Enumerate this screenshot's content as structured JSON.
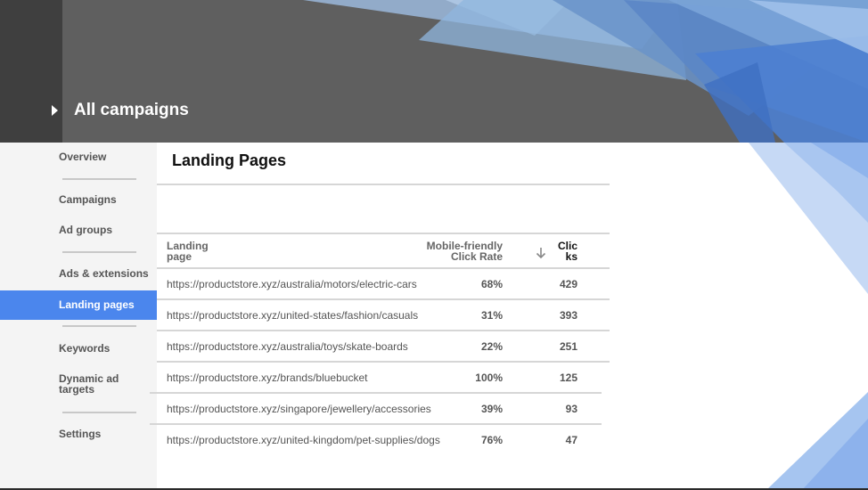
{
  "header": {
    "title": "All campaigns",
    "toggle_icon": "caret-right-icon"
  },
  "sidebar": {
    "items": [
      {
        "label": "Overview",
        "active": false
      },
      {
        "label": "Campaigns",
        "active": false
      },
      {
        "label": "Ad groups",
        "active": false
      },
      {
        "label": "Ads & extensions",
        "active": false
      },
      {
        "label": "Landing pages",
        "active": true
      },
      {
        "label": "Keywords",
        "active": false
      },
      {
        "label": "Dynamic ad targets",
        "active": false
      },
      {
        "label": "Settings",
        "active": false
      }
    ]
  },
  "main": {
    "title": "Landing Pages",
    "table": {
      "columns": {
        "landing_page": "Landing page",
        "mobile_rate": "Mobile-friendly Click Rate",
        "clicks": "Clicks"
      },
      "sort_icon": "arrow-down-icon",
      "rows": [
        {
          "url": "https://productstore.xyz/australia/motors/electric-cars",
          "rate": "68%",
          "clicks": "429"
        },
        {
          "url": "https://productstore.xyz/united-states/fashion/casuals",
          "rate": "31%",
          "clicks": "393"
        },
        {
          "url": "https://productstore.xyz/australia/toys/skate-boards",
          "rate": "22%",
          "clicks": "251"
        },
        {
          "url": "https://productstore.xyz/brands/bluebucket",
          "rate": "100%",
          "clicks": "125"
        },
        {
          "url": "https://productstore.xyz/singapore/jewellery/accessories",
          "rate": "39%",
          "clicks": "93"
        },
        {
          "url": "https://productstore.xyz/united-kingdom/pet-supplies/dogs",
          "rate": "76%",
          "clicks": "47"
        }
      ]
    }
  },
  "colors": {
    "accent": "#4b86ed",
    "header_bg": "#5f5f5f",
    "header_left": "#3f3f3f",
    "sidebar_bg": "#f4f4f4"
  }
}
